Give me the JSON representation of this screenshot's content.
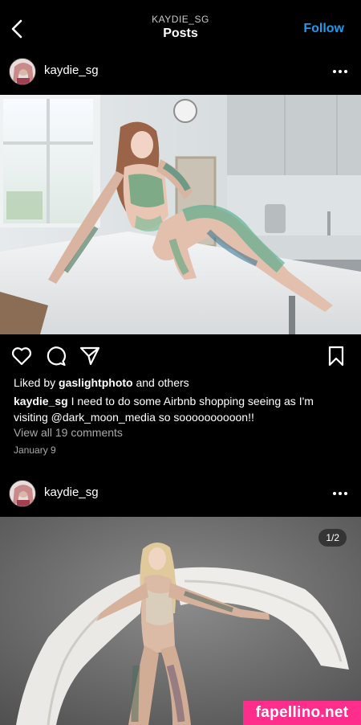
{
  "header": {
    "subtitle": "KAYDIE_SG",
    "title": "Posts",
    "follow_label": "Follow"
  },
  "posts": [
    {
      "username": "kaydie_sg",
      "liked_prefix": "Liked by ",
      "liked_by": "gaslightphoto",
      "liked_suffix": " and others",
      "caption_user": "kaydie_sg",
      "caption_text": " I need to do some Airbnb shopping seeing as I'm visiting @dark_moon_media so soooooooooon!!",
      "view_comments": "View all 19 comments",
      "date": "January 9"
    },
    {
      "username": "kaydie_sg",
      "media_counter": "1/2"
    }
  ],
  "watermark": "fapellino.net"
}
